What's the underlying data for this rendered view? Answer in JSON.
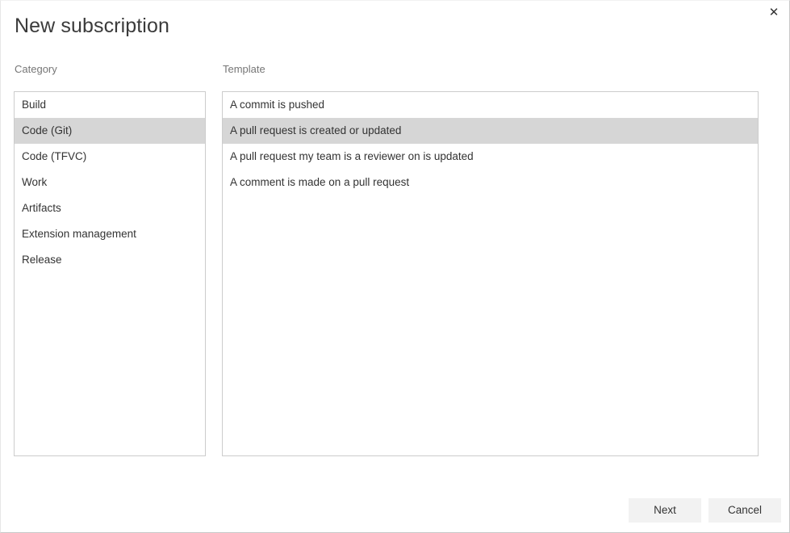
{
  "dialog": {
    "title": "New subscription",
    "close_label": "✕"
  },
  "category": {
    "label": "Category",
    "items": [
      {
        "label": "Build",
        "selected": false
      },
      {
        "label": "Code (Git)",
        "selected": true
      },
      {
        "label": "Code (TFVC)",
        "selected": false
      },
      {
        "label": "Work",
        "selected": false
      },
      {
        "label": "Artifacts",
        "selected": false
      },
      {
        "label": "Extension management",
        "selected": false
      },
      {
        "label": "Release",
        "selected": false
      }
    ]
  },
  "template": {
    "label": "Template",
    "items": [
      {
        "label": "A commit is pushed",
        "selected": false
      },
      {
        "label": "A pull request is created or updated",
        "selected": true
      },
      {
        "label": "A pull request my team is a reviewer on is updated",
        "selected": false
      },
      {
        "label": "A comment is made on a pull request",
        "selected": false
      }
    ]
  },
  "buttons": {
    "next": "Next",
    "cancel": "Cancel"
  },
  "colors": {
    "selection": "#d6d6d6",
    "button_bg": "#f2f2f2",
    "border": "#cccccc",
    "text": "#333333",
    "label_text": "#767676"
  }
}
